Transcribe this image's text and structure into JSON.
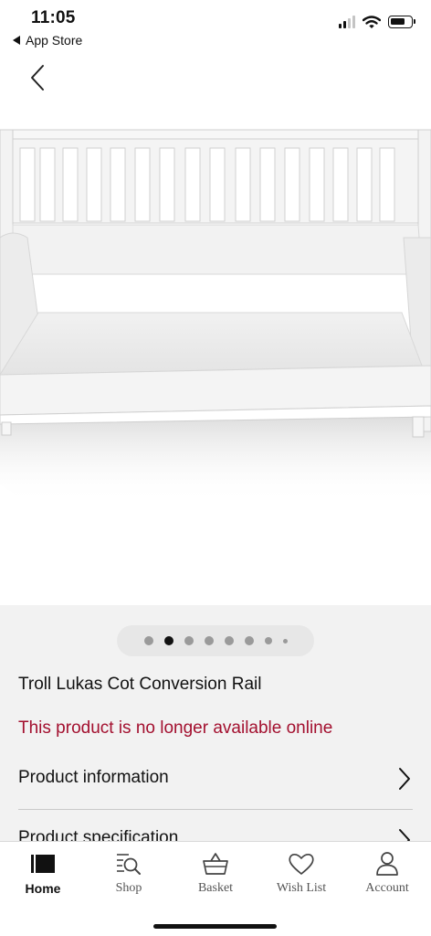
{
  "status": {
    "time": "11:05",
    "back_app": "App Store"
  },
  "product": {
    "title": "Troll Lukas Cot Conversion Rail",
    "availability": "This product is no longer available online",
    "image_carousel": {
      "count": 8,
      "active_index": 1
    }
  },
  "sections": [
    {
      "label": "Product information",
      "icon": "chevron-right-icon"
    },
    {
      "label": "Product specification",
      "icon": "chevron-right-icon"
    }
  ],
  "tabbar": {
    "items": [
      {
        "label": "Home",
        "icon": "home-icon",
        "active": true
      },
      {
        "label": "Shop",
        "icon": "shop-search-icon",
        "active": false
      },
      {
        "label": "Basket",
        "icon": "basket-icon",
        "active": false
      },
      {
        "label": "Wish List",
        "icon": "heart-icon",
        "active": false
      },
      {
        "label": "Account",
        "icon": "account-icon",
        "active": false
      }
    ]
  },
  "colors": {
    "alert_text": "#a3102f",
    "panel_background": "#f2f2f2",
    "active_tab": "#111111"
  }
}
